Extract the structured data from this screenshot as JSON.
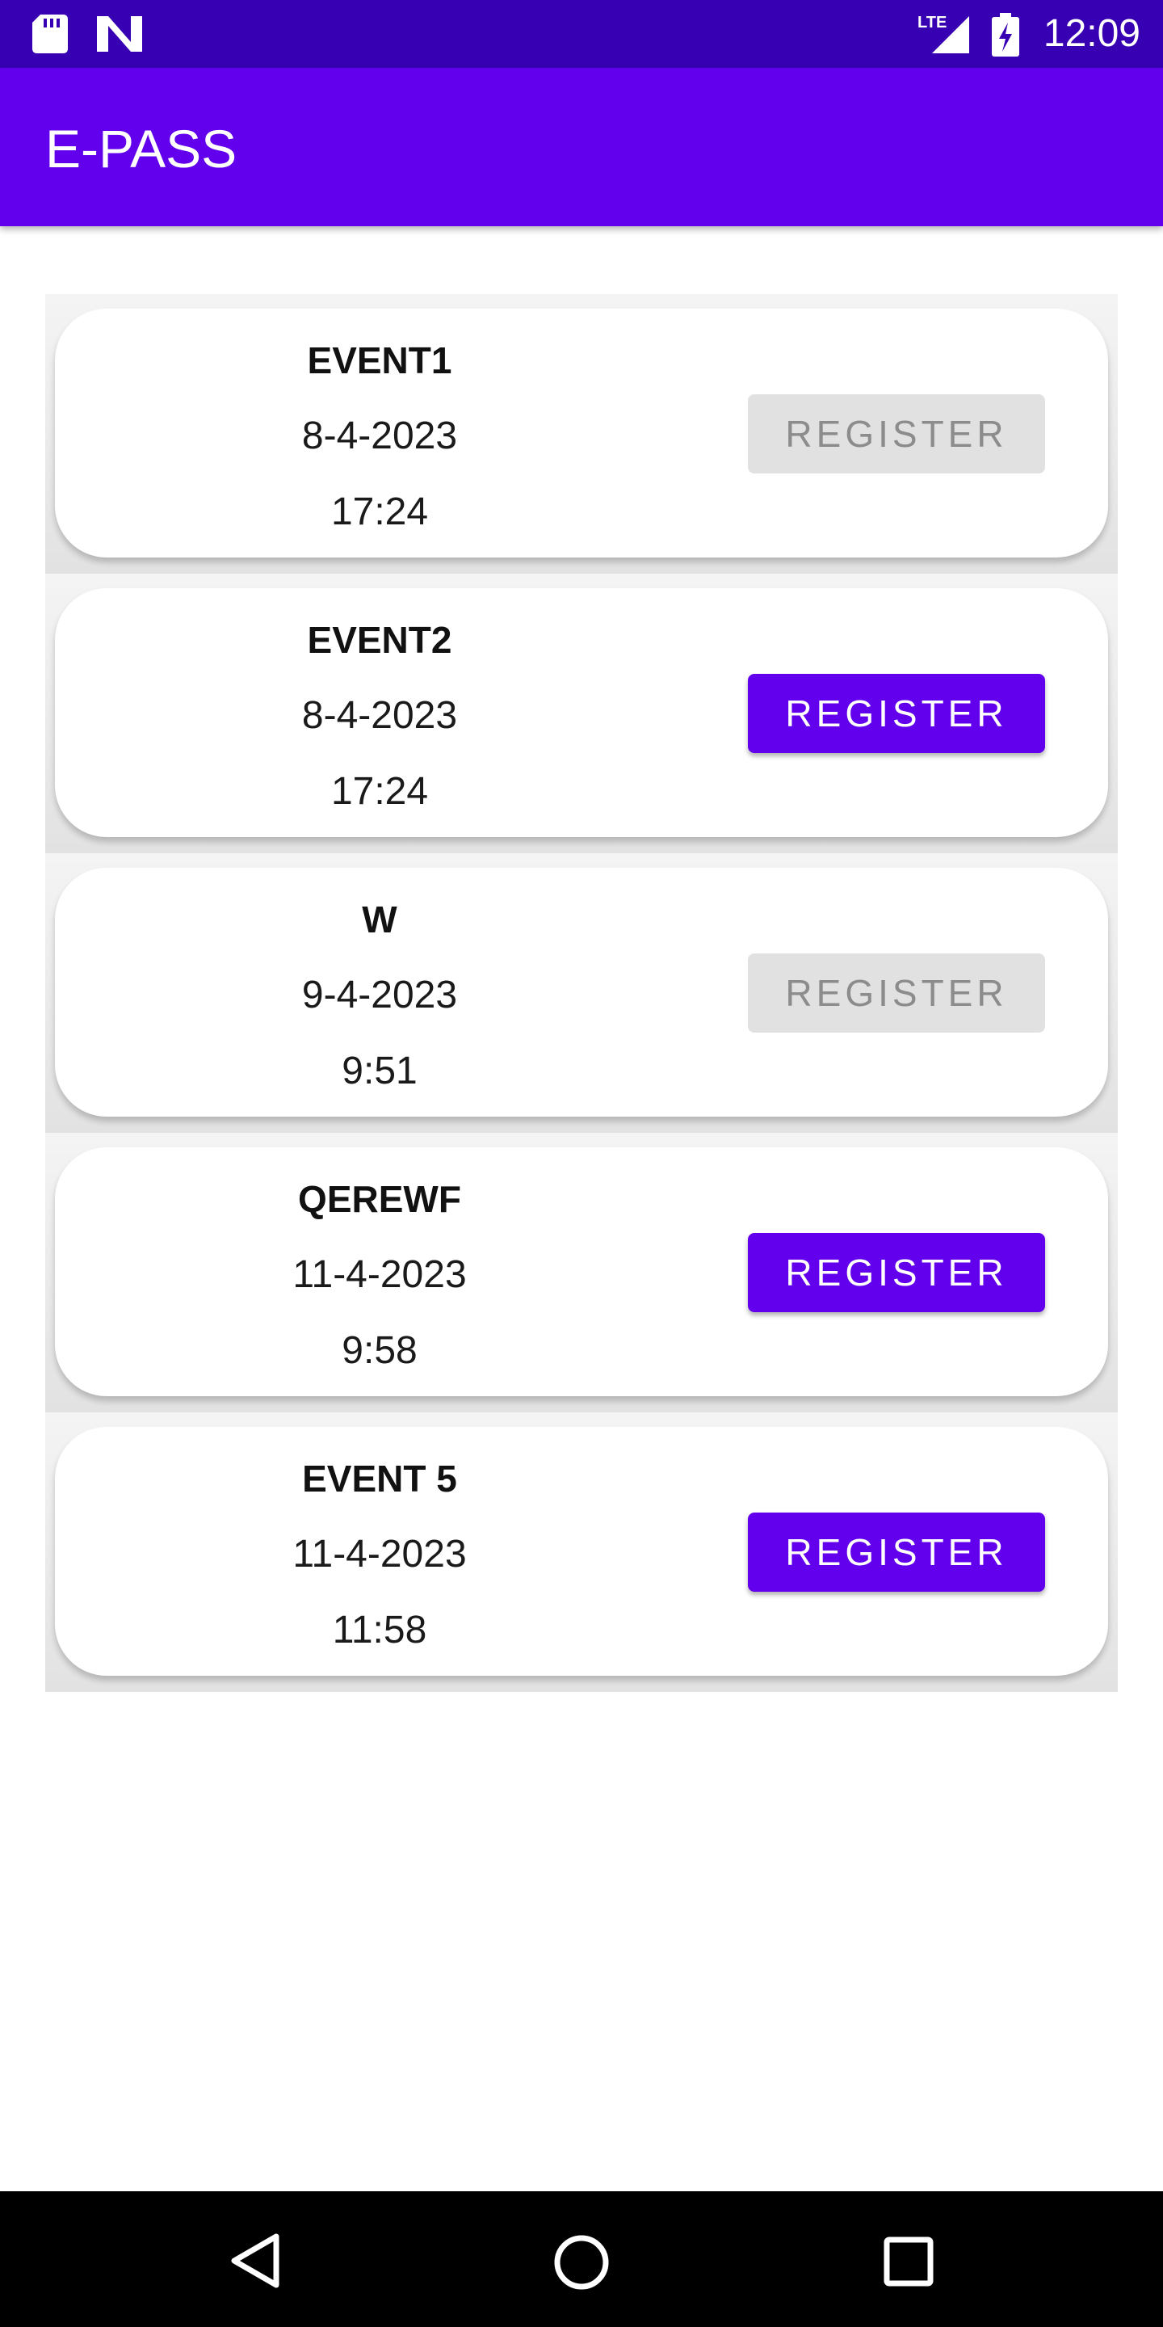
{
  "status_bar": {
    "time": "12:09",
    "network_label": "LTE",
    "icons": [
      "sd-card-icon",
      "n-notification-icon",
      "lte-signal-icon",
      "battery-charging-icon"
    ]
  },
  "app_bar": {
    "title": "E-PASS",
    "color": "#6200ee"
  },
  "colors": {
    "status_bar": "#3700b3",
    "accent": "#6200ee",
    "button_disabled_bg": "#e1e1e1",
    "button_disabled_text": "#8c8c8c"
  },
  "events": [
    {
      "name": "EVENT1",
      "date": "8-4-2023",
      "time": "17:24",
      "button_label": "REGISTER",
      "button_enabled": false
    },
    {
      "name": "EVENT2",
      "date": "8-4-2023",
      "time": "17:24",
      "button_label": "REGISTER",
      "button_enabled": true
    },
    {
      "name": "W",
      "date": "9-4-2023",
      "time": "9:51",
      "button_label": "REGISTER",
      "button_enabled": false
    },
    {
      "name": "QEREWF",
      "date": "11-4-2023",
      "time": "9:58",
      "button_label": "REGISTER",
      "button_enabled": true
    },
    {
      "name": "EVENT 5",
      "date": "11-4-2023",
      "time": "11:58",
      "button_label": "REGISTER",
      "button_enabled": true
    }
  ],
  "nav_bar": {
    "icons": [
      "back-icon",
      "home-icon",
      "recents-icon"
    ]
  }
}
